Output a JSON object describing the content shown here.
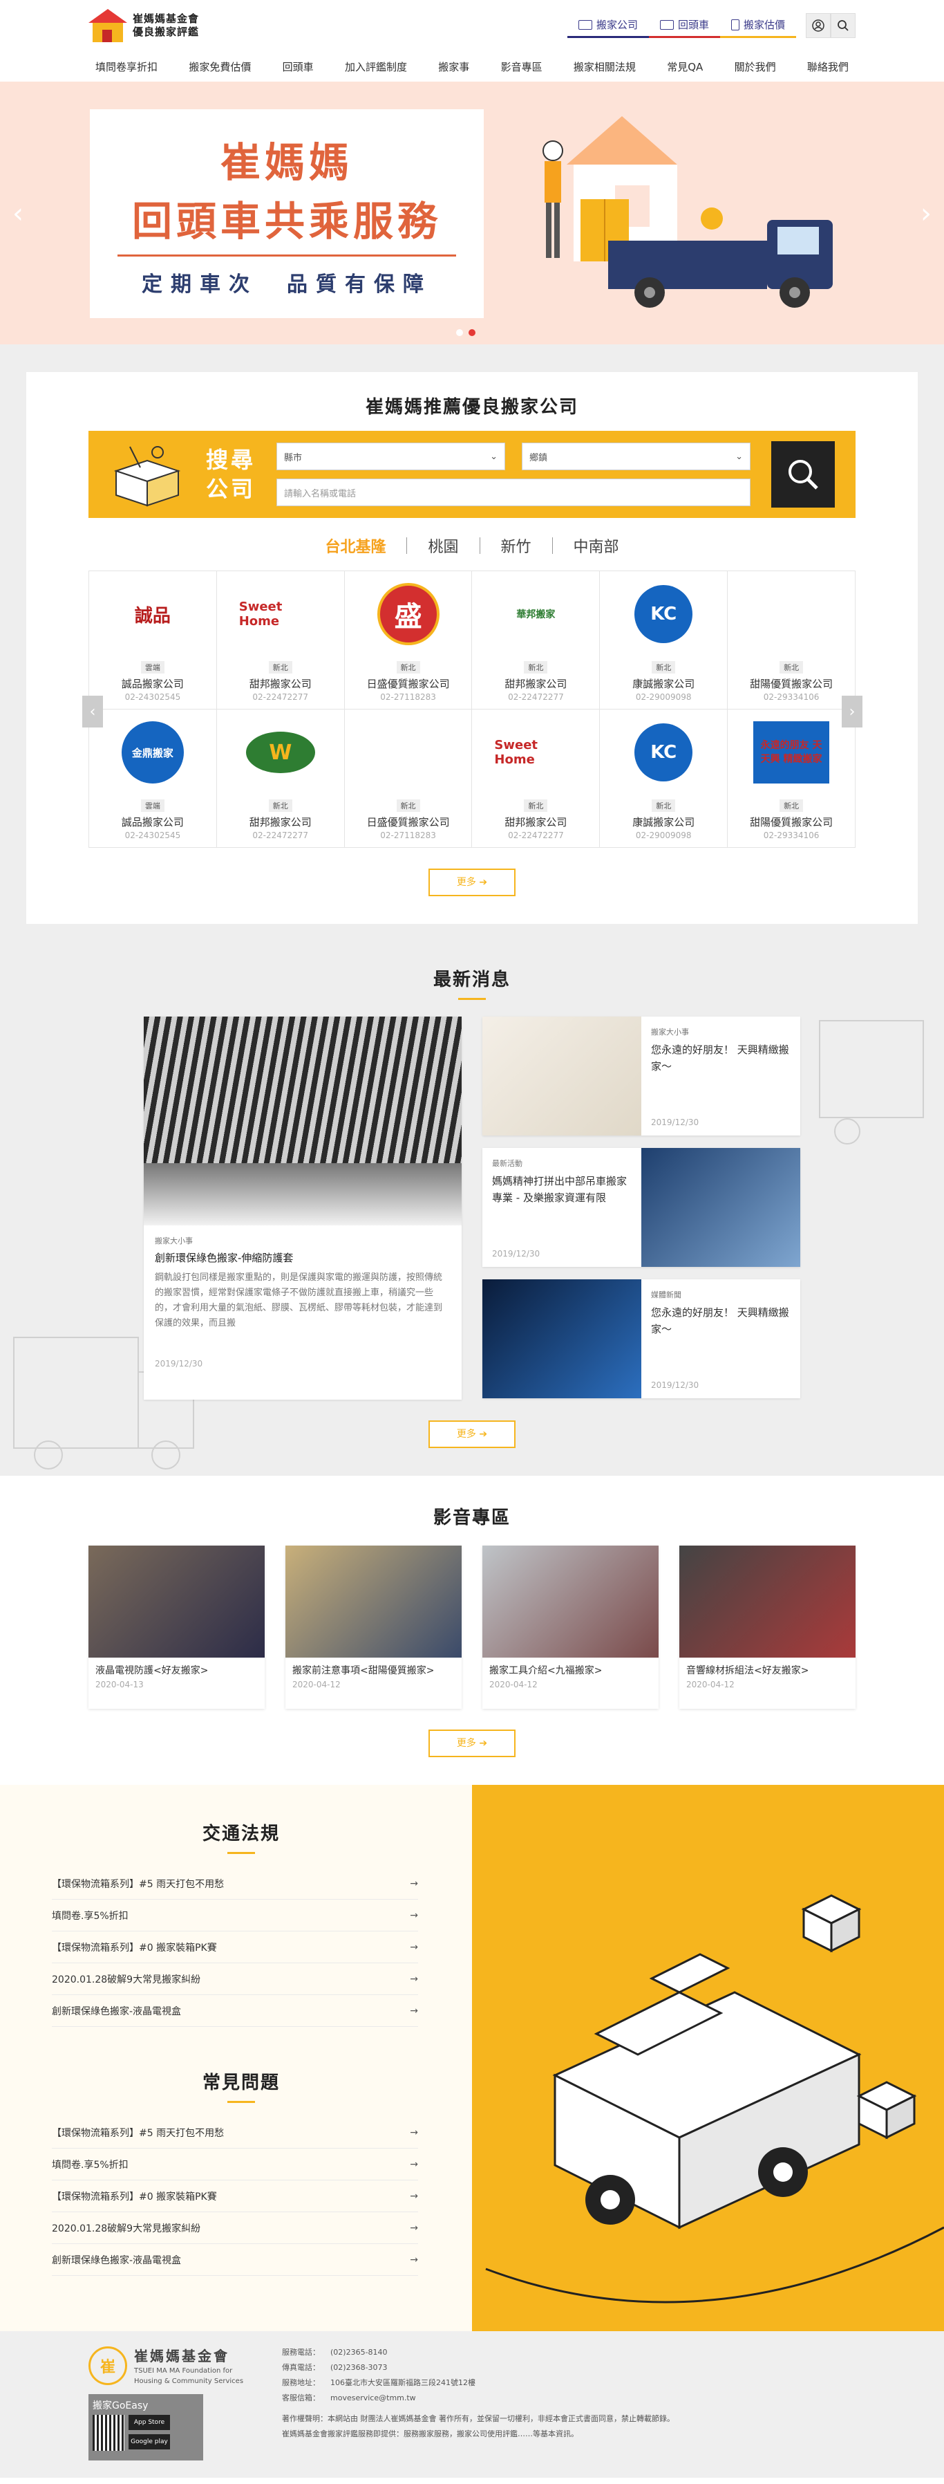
{
  "header": {
    "logo_line1": "崔媽媽基金會",
    "logo_line2": "優良搬家評鑑",
    "quick_links": [
      "搬家公司",
      "回頭車",
      "搬家估價"
    ],
    "user_icon": "user-icon",
    "search_icon": "search-icon"
  },
  "nav": [
    "填問卷享折扣",
    "搬家免費估價",
    "回頭車",
    "加入評鑑制度",
    "搬家事",
    "影音專區",
    "搬家相關法規",
    "常見QA",
    "關於我們",
    "聯絡我們"
  ],
  "banner": {
    "title_line1": "崔媽媽",
    "title_line2": "回頭車共乘服務",
    "subtitle": "定期車次　品質有保障",
    "bg_color": "#fde3d8",
    "accent": "#e0643c"
  },
  "recommend": {
    "title": "崔媽媽推薦優良搬家公司",
    "search_label1": "搜尋",
    "search_label2": "公司",
    "city_placeholder": "縣市",
    "district_placeholder": "鄉鎮",
    "name_placeholder": "請輸入名稱或電話",
    "tabs": [
      "台北基隆",
      "桃園",
      "新竹",
      "中南部"
    ],
    "companies": [
      {
        "name": "誠品搬家公司",
        "region": "雲端",
        "phone": "02-24302545",
        "logo": "誠品"
      },
      {
        "name": "甜邦搬家公司",
        "region": "新北",
        "phone": "02-22472277",
        "logo": "Sweet Home"
      },
      {
        "name": "日盛優質搬家公司",
        "region": "新北",
        "phone": "02-27118283",
        "logo": "盛"
      },
      {
        "name": "甜邦搬家公司",
        "region": "新北",
        "phone": "02-22472277",
        "logo": "華邦搬家"
      },
      {
        "name": "康誠搬家公司",
        "region": "新北",
        "phone": "02-29009098",
        "logo": "KC"
      },
      {
        "name": "甜陽優質搬家公司",
        "region": "新北",
        "phone": "02-29334106",
        "logo": ""
      },
      {
        "name": "誠品搬家公司",
        "region": "雲端",
        "phone": "02-24302545",
        "logo": "金鼎搬家"
      },
      {
        "name": "甜邦搬家公司",
        "region": "新北",
        "phone": "02-22472277",
        "logo": "W"
      },
      {
        "name": "日盛優質搬家公司",
        "region": "新北",
        "phone": "02-27118283",
        "logo": ""
      },
      {
        "name": "甜邦搬家公司",
        "region": "新北",
        "phone": "02-22472277",
        "logo": "Sweet Home"
      },
      {
        "name": "康誠搬家公司",
        "region": "新北",
        "phone": "02-29009098",
        "logo": "KC"
      },
      {
        "name": "甜陽優質搬家公司",
        "region": "新北",
        "phone": "02-29334106",
        "logo": "永遠的朋友 天天興 精緻搬家"
      }
    ],
    "more": "更多 ➔"
  },
  "news": {
    "title": "最新消息",
    "main": {
      "tag": "搬家大小事",
      "title": "創新環保綠色搬家-伸縮防護套",
      "text": "鋼軌設打包同樣是搬家重點的，則是保護與家電的搬運與防護，按照傳統的搬家習慣，經常對保護家電條子不做防護就直接搬上車，稍議究一些的，才會利用大量的氣泡紙、膠膜、瓦楞紙、膠帶等耗材包裝，才能達到保護的效果，而且搬",
      "date": "2019/12/30"
    },
    "side": [
      {
        "tag": "搬家大小事",
        "title": "您永遠的好朋友！ 天興精緻搬家～",
        "date": "2019/12/30"
      },
      {
        "tag": "最新活動",
        "title": "媽媽精神打拼出中部吊車搬家專業 - 及樂搬家資運有限",
        "date": "2019/12/30"
      },
      {
        "tag": "媒體新聞",
        "title": "您永遠的好朋友！ 天興精緻搬家～",
        "date": "2019/12/30"
      }
    ],
    "more": "更多 ➔"
  },
  "video": {
    "title": "影音專區",
    "items": [
      {
        "title": "液晶電視防護<好友搬家>",
        "date": "2020-04-13"
      },
      {
        "title": "搬家前注意事項<甜陽優質搬家>",
        "date": "2020-04-12"
      },
      {
        "title": "搬家工具介紹<九福搬家>",
        "date": "2020-04-12"
      },
      {
        "title": "音響線材拆組法<好友搬家>",
        "date": "2020-04-12"
      }
    ],
    "more": "更多 ➔"
  },
  "laws": {
    "title": "交通法規",
    "items": [
      "【環保物流箱系列】#5 雨天打包不用愁",
      "填問卷.享5%折扣",
      "【環保物流箱系列】#0 搬家裝箱PK賽",
      "2020.01.28破解9大常見搬家糾紛",
      "創新環保綠色搬家-液晶電視盒"
    ]
  },
  "faq": {
    "title": "常見問題",
    "items": [
      "【環保物流箱系列】#5 雨天打包不用愁",
      "填問卷.享5%折扣",
      "【環保物流箱系列】#0 搬家裝箱PK賽",
      "2020.01.28破解9大常見搬家糾紛",
      "創新環保綠色搬家-液晶電視盒"
    ]
  },
  "footer": {
    "name": "崔媽媽基金會",
    "name_en1": "TSUEI MA MA Foundation for",
    "name_en2": "Housing & Community Services",
    "app_label": "搬家GoEasy",
    "app_store": "App Store",
    "google_play": "Google play",
    "info": [
      {
        "label": "服務電話：",
        "value": "(02)2365-8140"
      },
      {
        "label": "傳真電話：",
        "value": "(02)2368-3073"
      },
      {
        "label": "服務地址：",
        "value": "106臺北市大安區羅斯福路三段241號12樓"
      },
      {
        "label": "客服信箱：",
        "value": "moveservice@tmm.tw"
      }
    ],
    "copyright1": "著作權聲明：本網站由 財團法人崔媽媽基金會 著作所有，並保留一切權利，非經本會正式書面同意，禁止轉載節錄。",
    "copyright2": "崔媽媽基金會搬家評鑑服務即提供：服務搬家服務，搬家公司使用評鑑……等基本資訊。"
  }
}
